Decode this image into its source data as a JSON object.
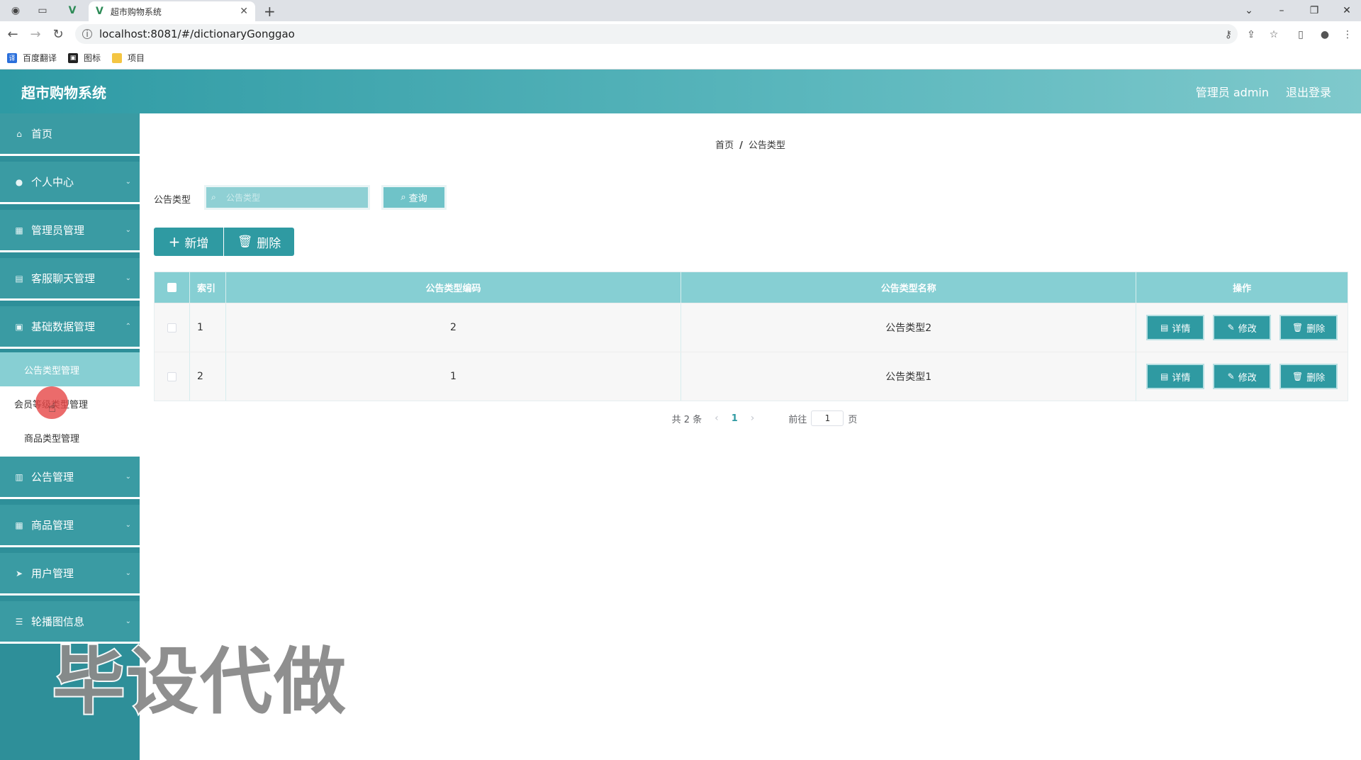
{
  "browser": {
    "tab_title": "超市购物系统",
    "url": "localhost:8081/#/dictionaryGonggao",
    "bookmarks": [
      "百度翻译",
      "图标",
      "项目"
    ]
  },
  "header": {
    "title": "超市购物系统",
    "user": "管理员 admin",
    "logout": "退出登录"
  },
  "sidebar": {
    "items": [
      {
        "label": "首页",
        "icon": "home-icon"
      },
      {
        "label": "个人中心",
        "icon": "user-icon"
      },
      {
        "label": "管理员管理",
        "icon": "grid-icon"
      },
      {
        "label": "客服聊天管理",
        "icon": "clipboard-icon"
      },
      {
        "label": "基础数据管理",
        "icon": "card-icon"
      },
      {
        "label": "公告管理",
        "icon": "chart-icon"
      },
      {
        "label": "商品管理",
        "icon": "grid-icon"
      },
      {
        "label": "用户管理",
        "icon": "send-icon"
      },
      {
        "label": "轮播图信息",
        "icon": "sliders-icon"
      }
    ],
    "submenu": [
      "公告类型管理",
      "会员等级类型管理",
      "商品类型管理"
    ]
  },
  "main": {
    "breadcrumb": {
      "home": "首页",
      "current": "公告类型"
    },
    "search": {
      "label": "公告类型",
      "placeholder": "公告类型",
      "button": "查询"
    },
    "actions": {
      "add": "新增",
      "delete": "删除"
    },
    "table": {
      "headers": [
        "索引",
        "公告类型编码",
        "公告类型名称",
        "操作"
      ],
      "rows": [
        {
          "index": "1",
          "code": "2",
          "name": "公告类型2"
        },
        {
          "index": "2",
          "code": "1",
          "name": "公告类型1"
        }
      ],
      "ops": {
        "detail": "详情",
        "edit": "修改",
        "delete": "删除"
      }
    },
    "pager": {
      "total": "共 2 条",
      "current": "1",
      "goto": "前往",
      "goto_value": "1",
      "page_unit": "页"
    }
  },
  "watermark": "毕设代做"
}
